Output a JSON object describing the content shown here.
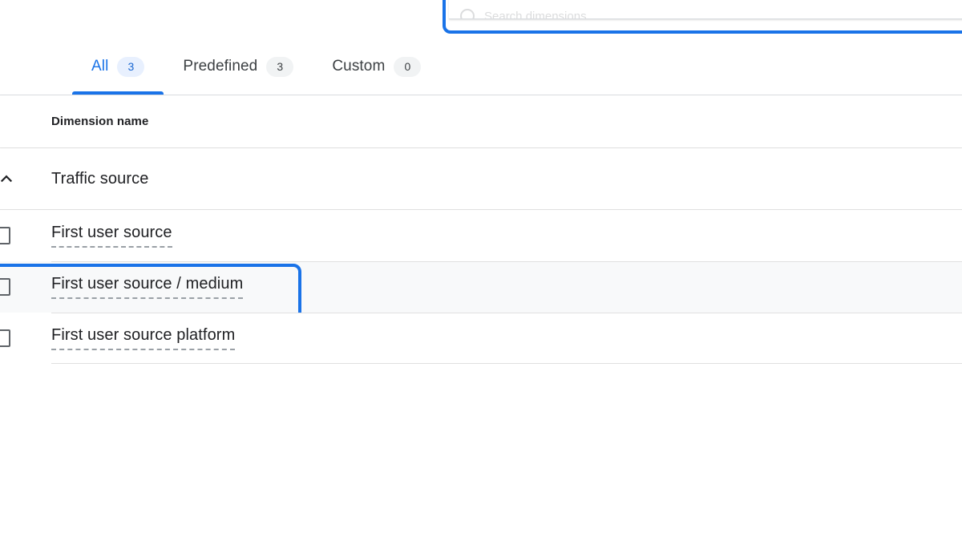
{
  "top_panel": {
    "search_icon": "search-icon",
    "search_value": "Search dimensions"
  },
  "tabs": [
    {
      "label": "All",
      "count": "3",
      "active": true
    },
    {
      "label": "Predefined",
      "count": "3",
      "active": false
    },
    {
      "label": "Custom",
      "count": "0",
      "active": false
    }
  ],
  "table": {
    "column_header": "Dimension name",
    "group": {
      "label": "Traffic source",
      "chevron_icon": "chevron-up-icon",
      "expanded": true
    },
    "rows": [
      {
        "label": "First user source",
        "checked": false,
        "focused": false
      },
      {
        "label": "First user source / medium",
        "checked": false,
        "focused": true
      },
      {
        "label": "First user source platform",
        "checked": false,
        "focused": false
      }
    ]
  },
  "colors": {
    "accent": "#1a73e8",
    "active_badge_bg": "#e8f0fe",
    "badge_bg": "#f1f3f4",
    "text": "#202124",
    "muted": "#5f6368",
    "divider": "#e0e0e0",
    "row_highlight": "#f8f9fa"
  }
}
